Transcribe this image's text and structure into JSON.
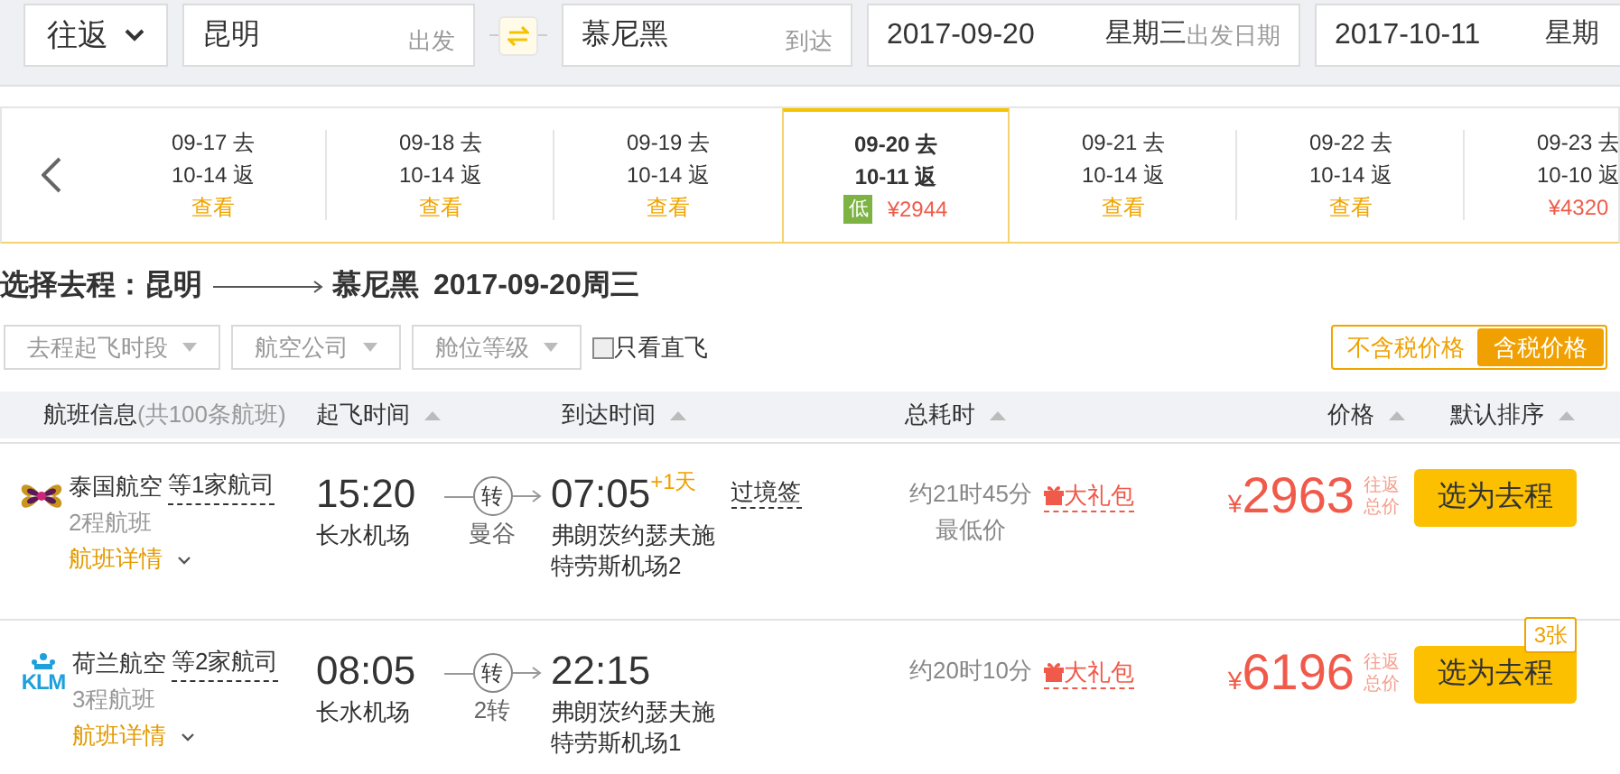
{
  "search": {
    "trip_type": "往返",
    "from": {
      "value": "昆明",
      "suffix": "出发"
    },
    "to": {
      "value": "慕尼黑",
      "suffix": "到达"
    },
    "depart_date": {
      "value": "2017-09-20",
      "weekday": "星期三",
      "suffix": "出发日期"
    },
    "return_date": {
      "value": "2017-10-11",
      "weekday": "星期"
    }
  },
  "date_strip": [
    {
      "depart": "09-17 去",
      "return": "10-14 返",
      "kind": "view",
      "link": "查看",
      "selected": false
    },
    {
      "depart": "09-18 去",
      "return": "10-14 返",
      "kind": "view",
      "link": "查看",
      "selected": false
    },
    {
      "depart": "09-19 去",
      "return": "10-14 返",
      "kind": "view",
      "link": "查看",
      "selected": false
    },
    {
      "depart": "09-20 去",
      "return": "10-11 返",
      "kind": "price",
      "badge": "低",
      "price": "¥2944",
      "selected": true
    },
    {
      "depart": "09-21 去",
      "return": "10-14 返",
      "kind": "view",
      "link": "查看",
      "selected": false
    },
    {
      "depart": "09-22 去",
      "return": "10-14 返",
      "kind": "view",
      "link": "查看",
      "selected": false
    },
    {
      "depart": "09-23 去",
      "return": "10-10 返",
      "kind": "price",
      "price": "¥4320",
      "selected": false
    }
  ],
  "heading": {
    "label": "选择去程：昆明",
    "to": "慕尼黑",
    "date": "2017-09-20周三"
  },
  "filters": [
    "去程起飞时段",
    "航空公司",
    "舱位等级"
  ],
  "direct_only": {
    "label": "只看直飞",
    "checked": false
  },
  "tax_toggle": [
    {
      "label": "不含税价格",
      "selected": false
    },
    {
      "label": "含税价格",
      "selected": true
    }
  ],
  "columns": [
    {
      "label": "航班信息",
      "note": "(共100条航班)",
      "sortable": false
    },
    {
      "label": "起飞时间",
      "sortable": true
    },
    {
      "label": "到达时间",
      "sortable": true
    },
    {
      "label": "总耗时",
      "sortable": true
    },
    {
      "label": "价格",
      "sortable": true
    },
    {
      "label": "默认排序",
      "sortable": true
    }
  ],
  "flights": [
    {
      "logo": {
        "kind": "orchid"
      },
      "airline": "泰国航空",
      "codeshare": "等1家航司",
      "legs": "2程航班",
      "details": "航班详情",
      "dep_time": "15:20",
      "dep_airport": "长水机场",
      "transfer": "转",
      "via": "曼谷",
      "arr_time": "07:05",
      "day_offset": "+1天",
      "arr_airport": "弗朗茨约瑟夫施特劳斯机场2",
      "visa": "过境签",
      "duration": "约21时45分",
      "tag": "最低价",
      "gift": "大礼包",
      "currency": "¥",
      "price": "2963",
      "price_note": "往返总价",
      "button": "选为去程"
    },
    {
      "logo": {
        "kind": "crown",
        "text": "KLM"
      },
      "airline": "荷兰航空",
      "codeshare": "等2家航司",
      "legs": "3程航班",
      "details": "航班详情",
      "dep_time": "08:05",
      "dep_airport": "长水机场",
      "transfer": "转",
      "via": "2转",
      "arr_time": "22:15",
      "arr_airport": "弗朗茨约瑟夫施特劳斯机场1",
      "duration": "约20时10分",
      "gift": "大礼包",
      "currency": "¥",
      "price": "6196",
      "price_note": "往返总价",
      "button": "选为去程",
      "tickets_left": "3张"
    }
  ]
}
